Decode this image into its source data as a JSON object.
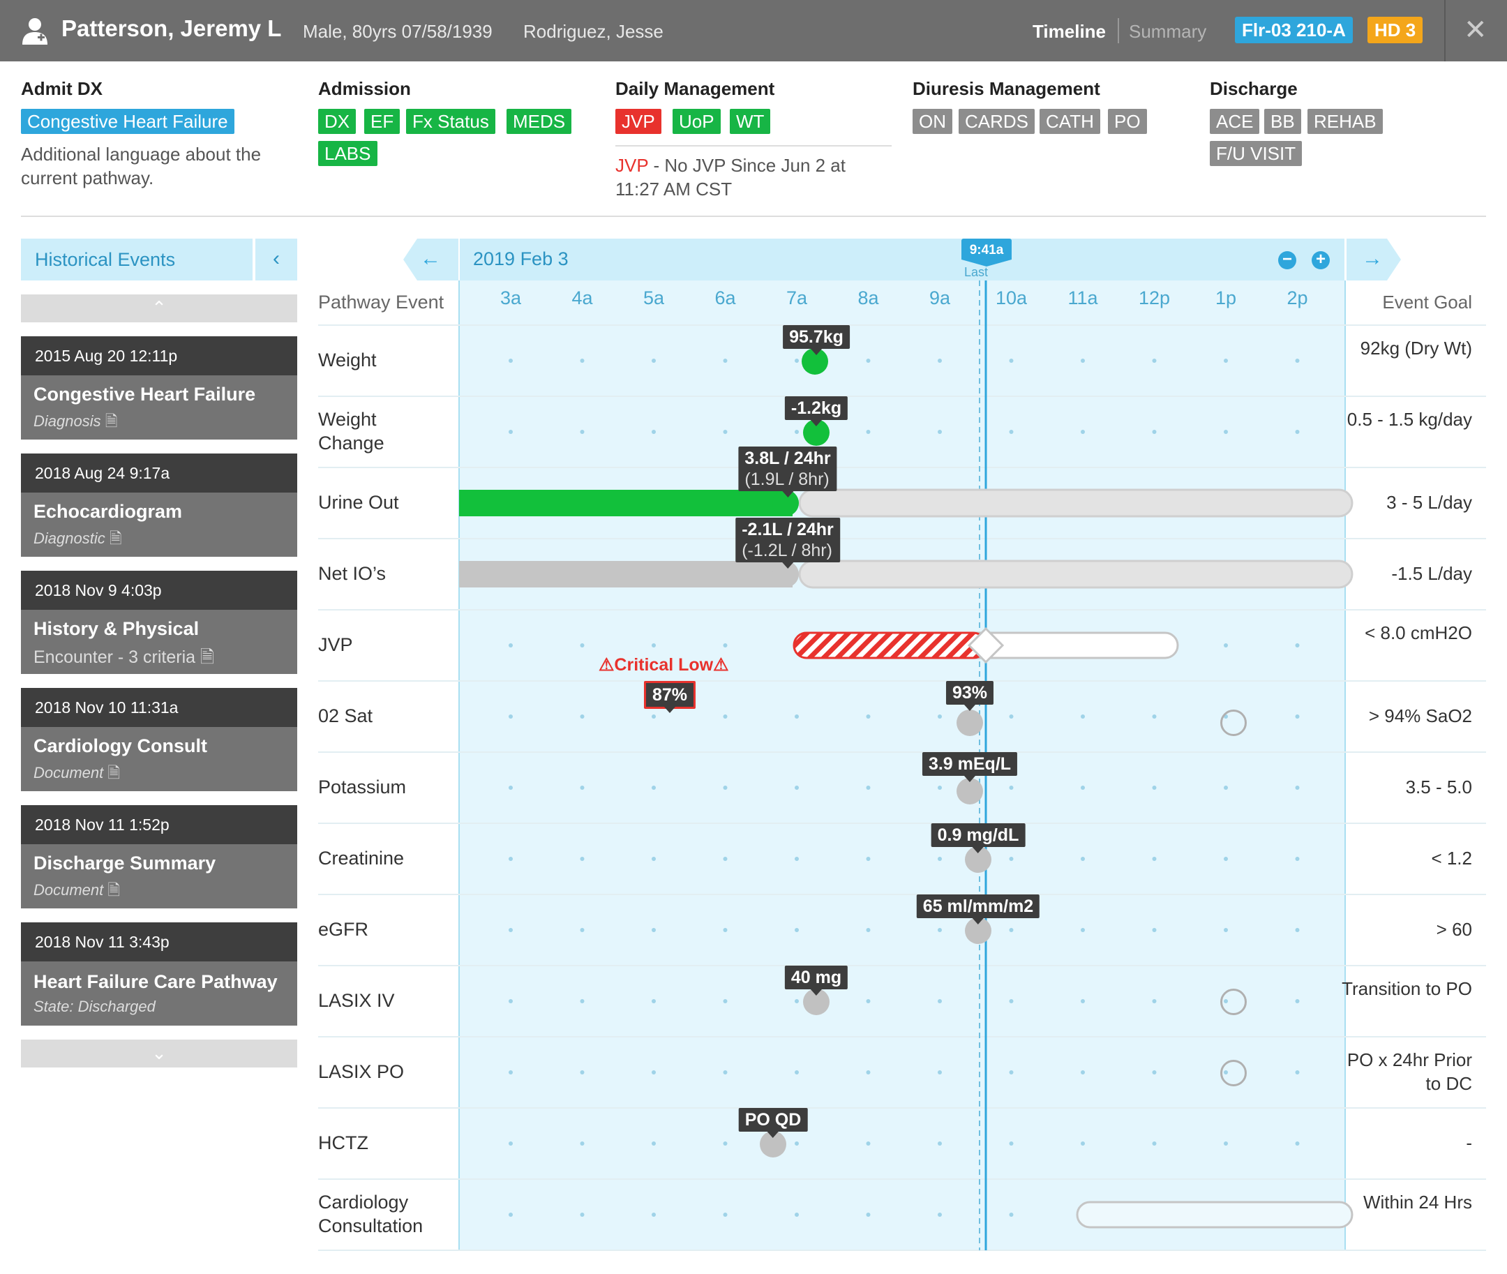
{
  "header": {
    "patient_name": "Patterson, Jeremy L",
    "demographics": "Male, 80yrs 07/58/1939",
    "provider": "Rodriguez, Jesse",
    "tab_timeline": "Timeline",
    "tab_summary": "Summary",
    "location": "Flr-03 210-A",
    "hospital_day": "HD 3",
    "close": "✕"
  },
  "pathway": {
    "admit": {
      "heading": "Admit DX",
      "tag": "Congestive Heart Failure",
      "description": "Additional language about the current pathway."
    },
    "admission": {
      "heading": "Admission",
      "tags": [
        "DX",
        "EF",
        "Fx Status",
        "MEDS",
        "LABS"
      ]
    },
    "daily": {
      "heading": "Daily Management",
      "tags": [
        "JVP",
        "UoP",
        "WT"
      ],
      "note_label": "JVP",
      "note_text": " - No JVP Since Jun 2 at 11:27 AM CST"
    },
    "diuresis": {
      "heading": "Diuresis Management",
      "tags": [
        "ON",
        "CARDS",
        "CATH",
        "PO"
      ]
    },
    "discharge": {
      "heading": "Discharge",
      "tags": [
        "ACE",
        "BB",
        "REHAB",
        "F/U VISIT"
      ]
    }
  },
  "sidebar": {
    "title": "Historical Events",
    "collapse": "‹",
    "up": "⌃",
    "down": "⌄",
    "events": [
      {
        "date": "2015 Aug 20 12:11p",
        "title": "Congestive Heart Failure",
        "subtitle": "Diagnosis"
      },
      {
        "date": "2018 Aug 24 9:17a",
        "title": "Echocardiogram",
        "subtitle": "Diagnostic"
      },
      {
        "date": "2018 Nov 9 4:03p",
        "title": "History & Physical",
        "subtitle": "Encounter - 3 criteria"
      },
      {
        "date": "2018 Nov 10 11:31a",
        "title": "Cardiology Consult",
        "subtitle": "Document"
      },
      {
        "date": "2018 Nov 11 1:52p",
        "title": "Discharge Summary",
        "subtitle": "Document"
      },
      {
        "date": "2018 Nov 11 3:43p",
        "title": "Heart Failure Care Pathway",
        "subtitle": "State: Discharged"
      }
    ]
  },
  "timeline": {
    "date": "2019 Feb 3",
    "now_label": "9:41a",
    "last_label": "Last",
    "col_header_left": "Pathway Event",
    "col_header_right": "Event Goal",
    "hours": [
      "3a",
      "4a",
      "5a",
      "6a",
      "7a",
      "8a",
      "9a",
      "10a",
      "11a",
      "12p",
      "1p",
      "2p"
    ],
    "rows": [
      {
        "label": "Weight",
        "goal": "92kg (Dry Wt)"
      },
      {
        "label": "Weight Change",
        "goal": "0.5 - 1.5 kg/day"
      },
      {
        "label": "Urine Out",
        "goal": "3 - 5 L/day"
      },
      {
        "label": "Net IO’s",
        "goal": "-1.5 L/day"
      },
      {
        "label": "JVP",
        "goal": "< 8.0 cmH2O"
      },
      {
        "label": "02 Sat",
        "goal": "> 94% SaO2"
      },
      {
        "label": "Potassium",
        "goal": "3.5 - 5.0"
      },
      {
        "label": "Creatinine",
        "goal": "< 1.2"
      },
      {
        "label": "eGFR",
        "goal": "> 60"
      },
      {
        "label": "LASIX IV",
        "goal": "Transition to PO"
      },
      {
        "label": "LASIX PO",
        "goal": "PO x 24hr Prior to DC"
      },
      {
        "label": "HCTZ",
        "goal": "-"
      },
      {
        "label": "Cardiology Consultation",
        "goal": "Within 24 Hrs"
      }
    ],
    "values": {
      "weight": "95.7kg",
      "weight_change": "-1.2kg",
      "urine_1": "3.8L / 24hr",
      "urine_2": "(1.9L / 8hr)",
      "netio_1": "-2.1L / 24hr",
      "netio_2": "(-1.2L / 8hr)",
      "critical": "Critical Low",
      "o2_low": "87%",
      "o2": "93%",
      "potassium": "3.9 mEq/L",
      "creatinine": "0.9 mg/dL",
      "egfr": "65 ml/mm/m2",
      "lasix_iv": "40 mg",
      "hctz": "PO QD"
    }
  },
  "colors": {
    "header_bg": "#6e6e6e",
    "accent_blue": "#2ea6dc",
    "green": "#17b545",
    "red": "#e8322d",
    "orange": "#f4a61a",
    "timeline_bg": "#e4f6fd"
  }
}
